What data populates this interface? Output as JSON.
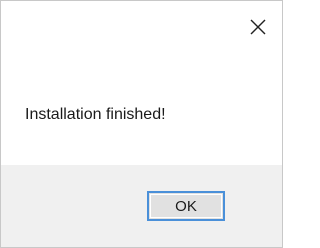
{
  "dialog": {
    "message": "Installation finished!",
    "ok_label": "OK",
    "close_icon": "close-icon"
  },
  "colors": {
    "footer_background": "#f0f0f0",
    "button_border_focus": "#4a90d9",
    "button_background": "#e1e1e1"
  }
}
